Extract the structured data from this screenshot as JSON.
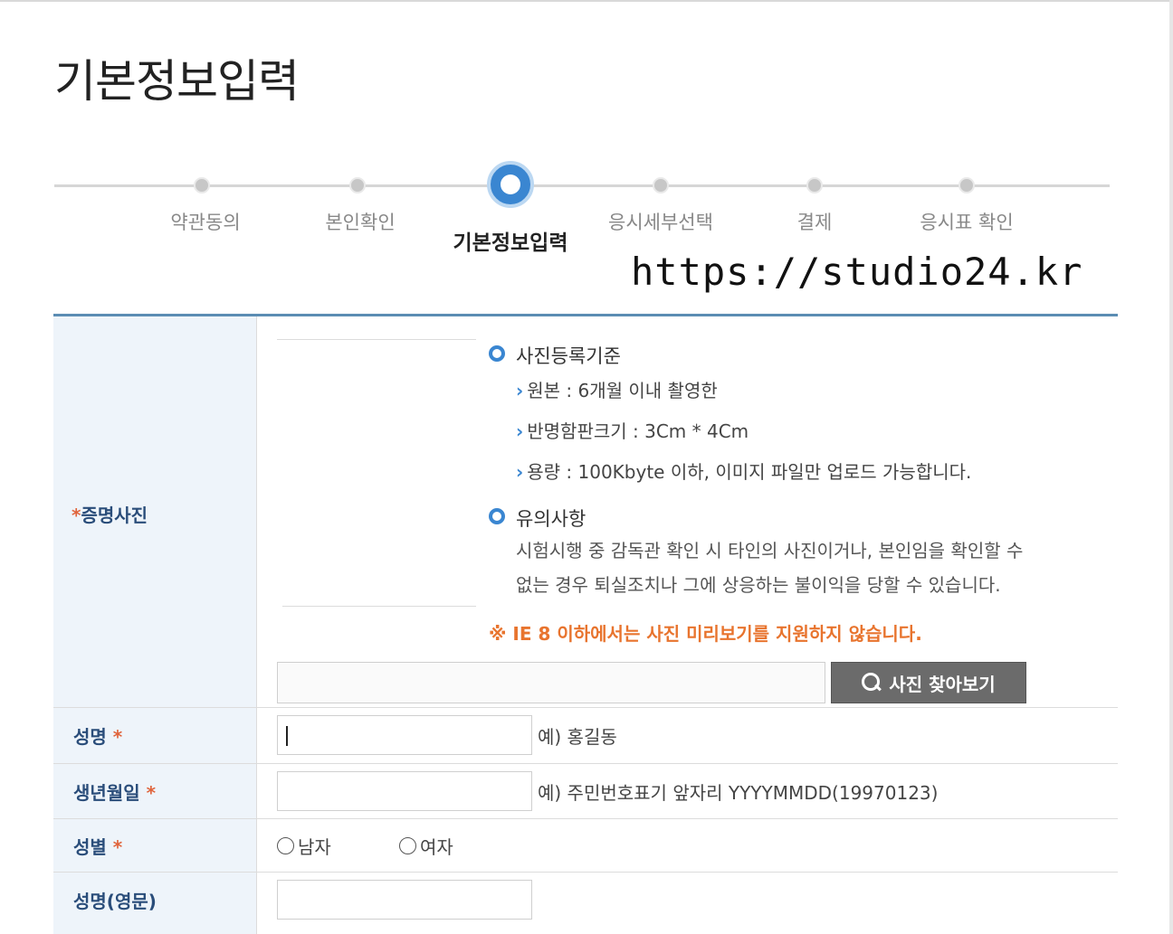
{
  "page": {
    "title": "기본정보입력",
    "watermark": "https://studio24.kr"
  },
  "stepper": {
    "steps": [
      {
        "label": "약관동의",
        "active": false
      },
      {
        "label": "본인확인",
        "active": false
      },
      {
        "label": "기본정보입력",
        "active": true
      },
      {
        "label": "응시세부선택",
        "active": false
      },
      {
        "label": "결제",
        "active": false
      },
      {
        "label": "응시표 확인",
        "active": false
      }
    ]
  },
  "photo": {
    "label": "증명사진",
    "required_mark": "*",
    "criteria_title": "사진등록기준",
    "criteria": [
      "원본 : 6개월 이내 촬영한",
      "반명함판크기 : 3Cm * 4Cm",
      "용량 : 100Kbyte 이하, 이미지 파일만 업로드 가능합니다."
    ],
    "notice_title": "유의사항",
    "notice_lines": [
      "시험시행 중 감독관 확인 시 타인의 사진이거나, 본인임을 확인할 수",
      "없는 경우 퇴실조치나 그에 상응하는 불이익을 당할 수 있습니다."
    ],
    "warning": "※ IE 8 이하에서는 사진 미리보기를 지원하지 않습니다.",
    "find_button": "사진 찾아보기",
    "file_value": ""
  },
  "name": {
    "label": "성명",
    "required_mark": "*",
    "value": "",
    "hint": "예) 홍길동"
  },
  "birth": {
    "label": "생년월일",
    "required_mark": "*",
    "value": "",
    "hint": "예) 주민번호표기 앞자리 YYYYMMDD(19970123)"
  },
  "gender": {
    "label": "성별",
    "required_mark": "*",
    "options": [
      "남자",
      "여자"
    ]
  },
  "name_en": {
    "label": "성명(영문)",
    "value": ""
  },
  "colors": {
    "accent": "#3a86d1",
    "label_text": "#2a4d7a",
    "warning": "#e8742e",
    "header_bg": "#eef4fa"
  }
}
